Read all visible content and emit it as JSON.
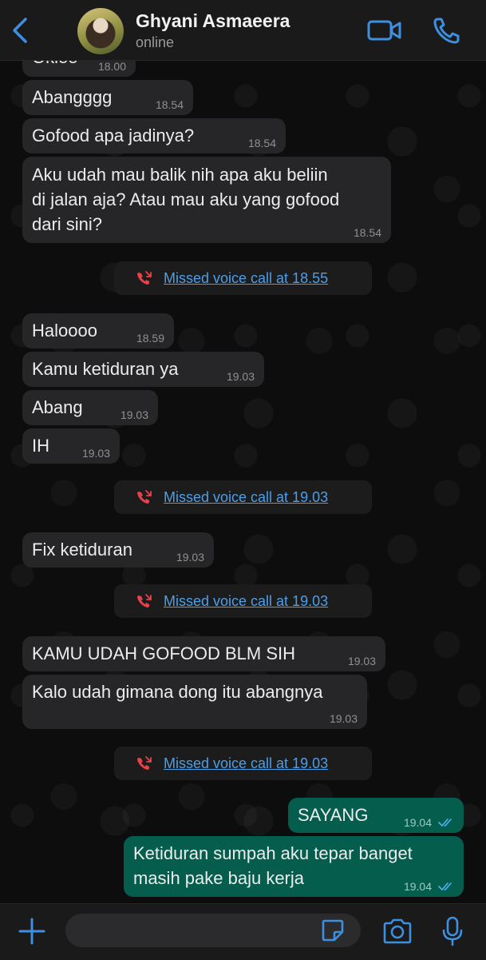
{
  "header": {
    "contact_name": "Ghyani Asmaeera",
    "status": "online"
  },
  "colors": {
    "accent": "#4b9fe8",
    "incoming_bubble": "#262628",
    "outgoing_bubble": "#055e4d",
    "missed_call_icon": "#e8414b"
  },
  "messages": [
    {
      "text": "Okiee",
      "time": "18.00"
    },
    {
      "text": "Abangggg",
      "time": "18.54"
    },
    {
      "text": "Gofood apa jadinya?",
      "time": "18.54"
    },
    {
      "text": "Aku udah mau balik nih apa aku beliin di jalan aja? Atau mau aku yang gofood dari sini?",
      "line1": "Aku udah mau balik nih apa aku beliin",
      "line2": "di jalan aja? Atau mau aku yang gofood",
      "line3": "dari sini?",
      "time": "18.54"
    },
    {
      "text": "Haloooo",
      "time": "18.59"
    },
    {
      "text": "Kamu ketiduran ya",
      "time": "19.03"
    },
    {
      "text": "Abang",
      "time": "19.03"
    },
    {
      "text": "IH",
      "time": "19.03"
    },
    {
      "text": "Fix ketiduran",
      "time": "19.03"
    },
    {
      "text": "KAMU UDAH GOFOOD BLM SIH",
      "time": "19.03"
    },
    {
      "text": "Kalo udah gimana dong itu abangnya",
      "time": "19.03"
    },
    {
      "text": "SAYANG",
      "time": "19.04"
    },
    {
      "text": "Ketiduran sumpah aku tepar banget masih pake baju kerja",
      "line1": "Ketiduran sumpah aku tepar banget",
      "line2": "masih pake baju kerja",
      "time": "19.04"
    }
  ],
  "missed_calls": [
    {
      "label": "Missed voice call at 18.55"
    },
    {
      "label": "Missed voice call at 19.03"
    },
    {
      "label": "Missed voice call at 19.03"
    },
    {
      "label": "Missed voice call at 19.03"
    }
  ],
  "composer": {
    "placeholder": ""
  }
}
